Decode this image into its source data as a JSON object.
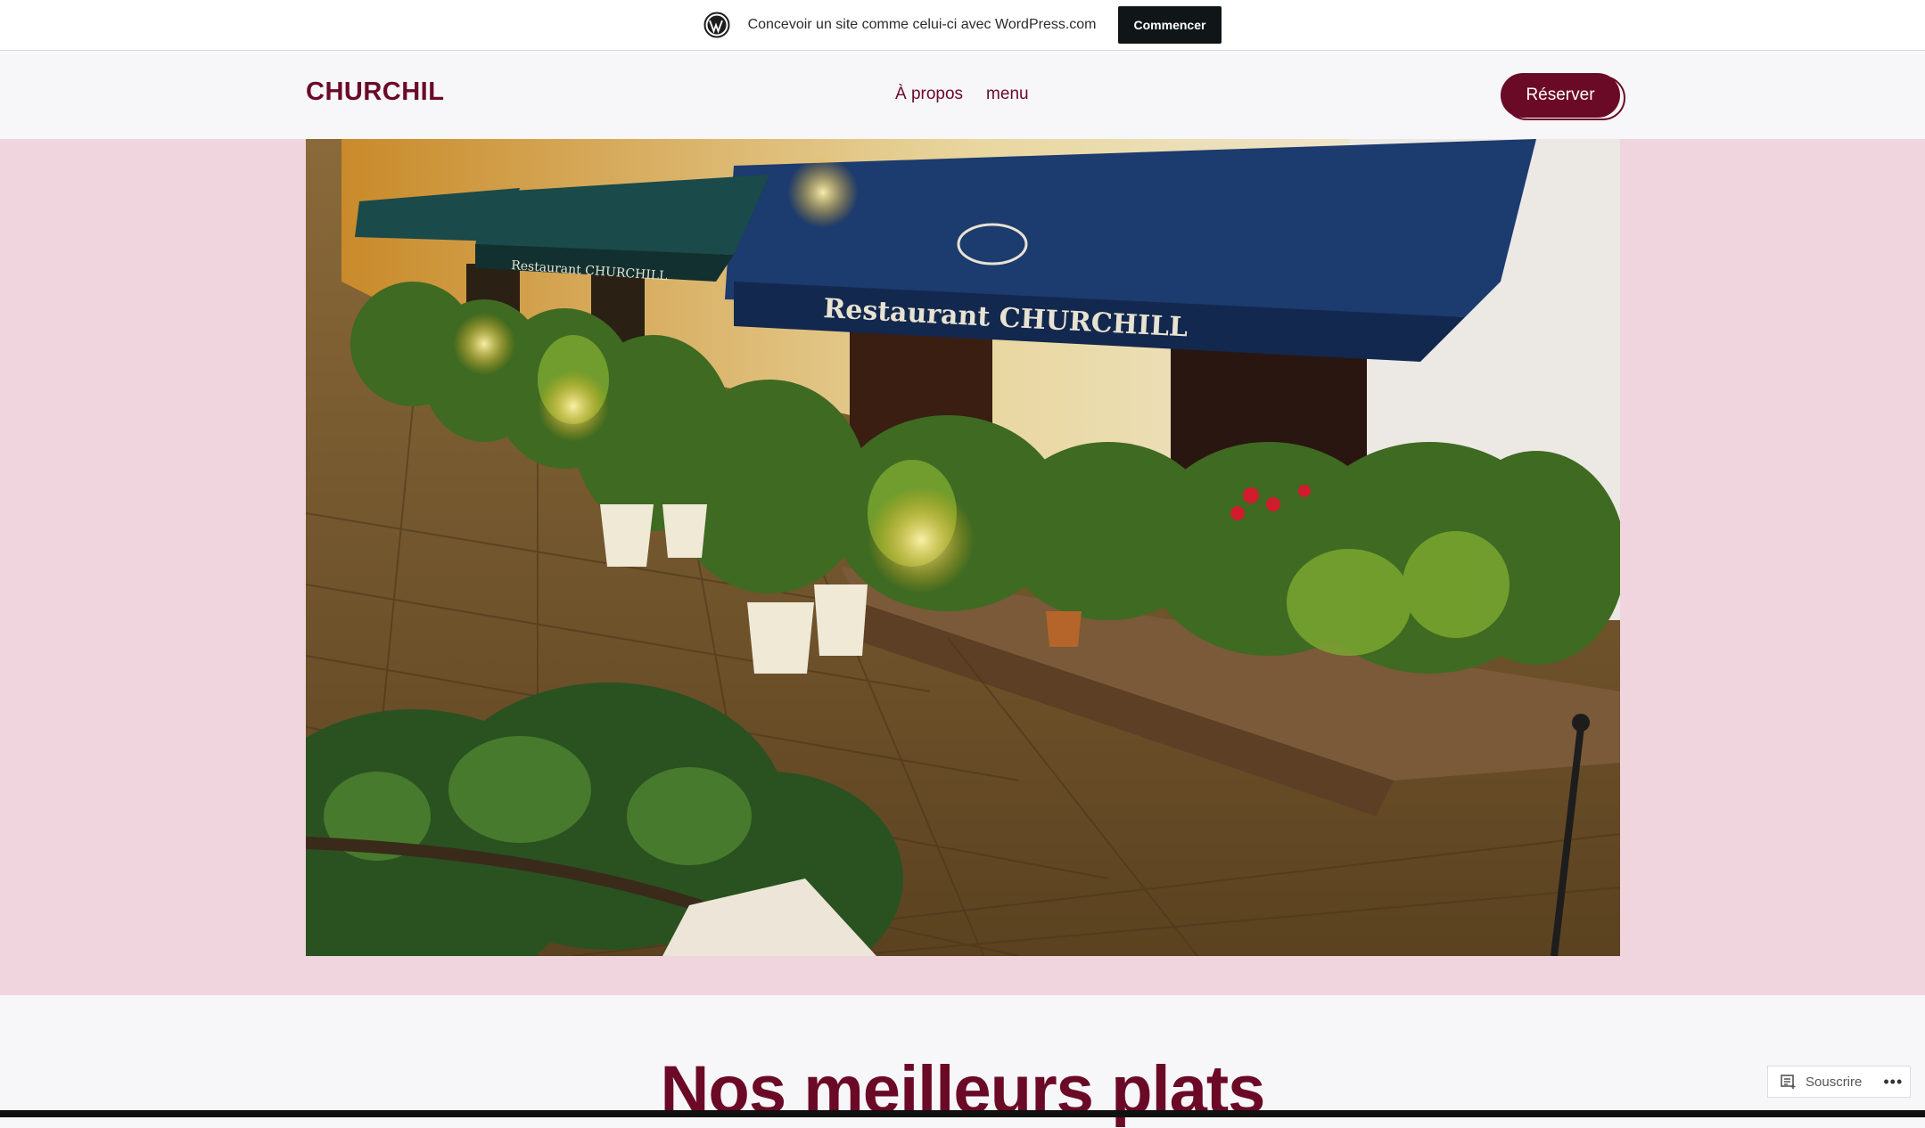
{
  "wp_banner": {
    "text": "Concevoir un site comme celui-ci avec WordPress.com",
    "button": "Commencer",
    "icon": "wordpress-logo-icon"
  },
  "header": {
    "site_title": "CHURCHIL",
    "nav": [
      {
        "label": "À propos"
      },
      {
        "label": "menu"
      }
    ],
    "reserve_button": "Réserver"
  },
  "hero": {
    "image": "Night photo of Restaurant Churchill terrace with lit plants and blue awnings",
    "awning_text": "Restaurant CHURCHILL",
    "awning_text_small": "Restaurant CHURCHILL"
  },
  "section": {
    "title": "Nos meilleurs plats"
  },
  "subscribe": {
    "label": "Souscrire",
    "more": "•••"
  },
  "colors": {
    "brand": "#6b0a27",
    "hero_band": "#f0d5df",
    "page_bg": "#f7f6f8"
  }
}
